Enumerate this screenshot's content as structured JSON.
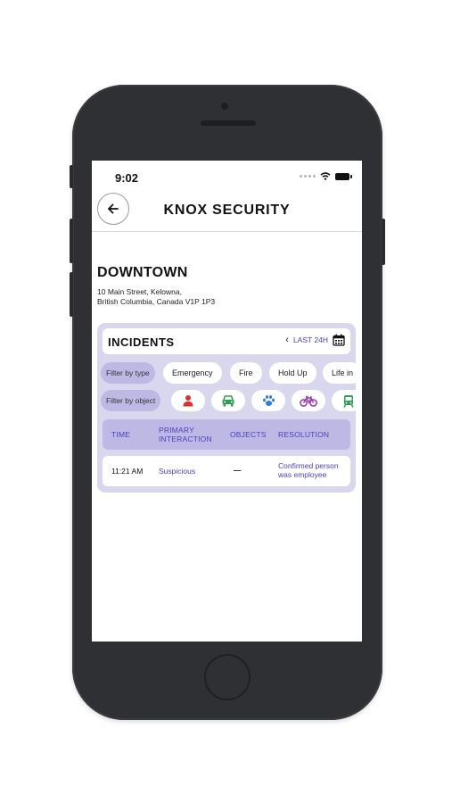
{
  "status_bar": {
    "time": "9:02"
  },
  "header": {
    "title": "KNOX SECURITY",
    "back_icon": "arrow-left-icon"
  },
  "location": {
    "name": "DOWNTOWN",
    "address_line1": "10 Main Street, Kelowna,",
    "address_line2": "British Columbia, Canada V1P 1P3"
  },
  "incidents": {
    "title": "INCIDENTS",
    "range_label": "LAST 24H",
    "filter_type_label": "Filter by type",
    "type_chips": [
      "Emergency",
      "Fire",
      "Hold Up",
      "Life in"
    ],
    "filter_object_label": "Filter by object",
    "object_chips": [
      {
        "icon": "person-icon",
        "color": "#d9322b"
      },
      {
        "icon": "car-icon",
        "color": "#2e9e54"
      },
      {
        "icon": "paw-icon",
        "color": "#2f7fd8"
      },
      {
        "icon": "bicycle-icon",
        "color": "#a03fb8"
      },
      {
        "icon": "bus-icon",
        "color": "#2e9e54"
      }
    ],
    "columns": [
      "TIME",
      "PRIMARY INTERACTION",
      "OBJECTS",
      "RESOLUTION"
    ],
    "rows": [
      {
        "time": "11:21 AM",
        "interaction": "Suspicious",
        "objects": "—",
        "resolution": "Confirmed person was employee"
      }
    ]
  },
  "colors": {
    "accent": "#4b3ec0",
    "panel": "#d9d7ee",
    "chip_active": "#bdb9e4"
  }
}
